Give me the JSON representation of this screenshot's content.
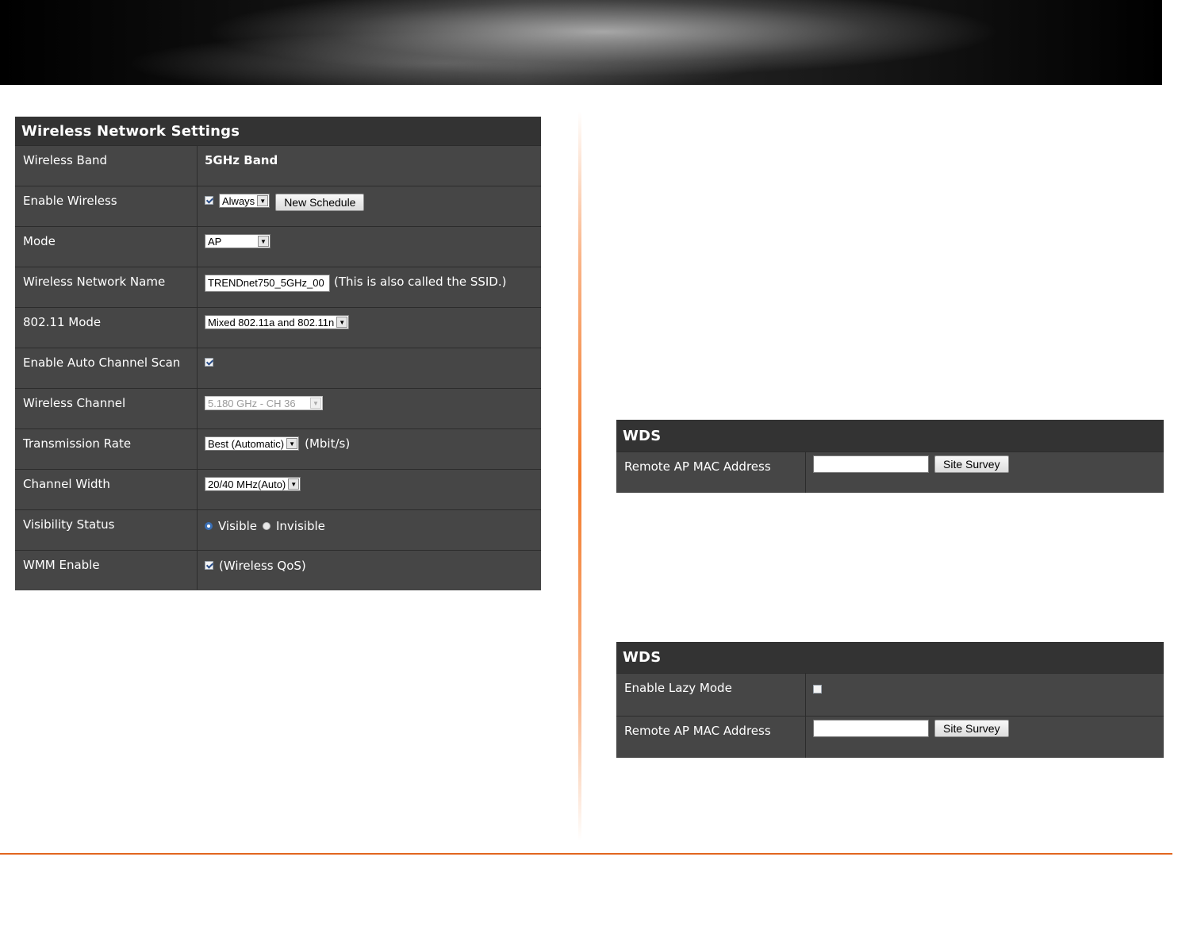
{
  "wireless": {
    "title": "Wireless Network Settings",
    "band_label": "Wireless Band",
    "band_value": "5GHz Band",
    "enable_label": "Enable Wireless",
    "enable_checked": true,
    "schedule_value": "Always",
    "new_schedule_button": "New Schedule",
    "mode_label": "Mode",
    "mode_value": "AP",
    "ssid_label": "Wireless Network Name",
    "ssid_value": "TRENDnet750_5GHz_00",
    "ssid_note": "(This is also called the SSID.)",
    "dot11_label": "802.11 Mode",
    "dot11_value": "Mixed 802.11a and 802.11n",
    "autoscan_label": "Enable Auto Channel Scan",
    "autoscan_checked": true,
    "channel_label": "Wireless Channel",
    "channel_value": "5.180 GHz - CH 36",
    "rate_label": "Transmission Rate",
    "rate_value": "Best (Automatic)",
    "rate_unit": "(Mbit/s)",
    "width_label": "Channel Width",
    "width_value": "20/40 MHz(Auto)",
    "visibility_label": "Visibility Status",
    "visible_option": "Visible",
    "invisible_option": "Invisible",
    "visibility_selected": "Visible",
    "wmm_label": "WMM Enable",
    "wmm_checked": true,
    "wmm_note": "(Wireless QoS)"
  },
  "wds1": {
    "title": "WDS",
    "mac_label": "Remote AP MAC Address",
    "mac_value": "",
    "site_survey_button": "Site Survey"
  },
  "wds2": {
    "title": "WDS",
    "lazy_label": "Enable Lazy Mode",
    "lazy_checked": false,
    "mac_label": "Remote AP MAC Address",
    "mac_value": "",
    "site_survey_button": "Site Survey"
  },
  "colors": {
    "panel_bg": "#464646",
    "header_bg": "#333333",
    "accent_orange": "#e2661f"
  }
}
